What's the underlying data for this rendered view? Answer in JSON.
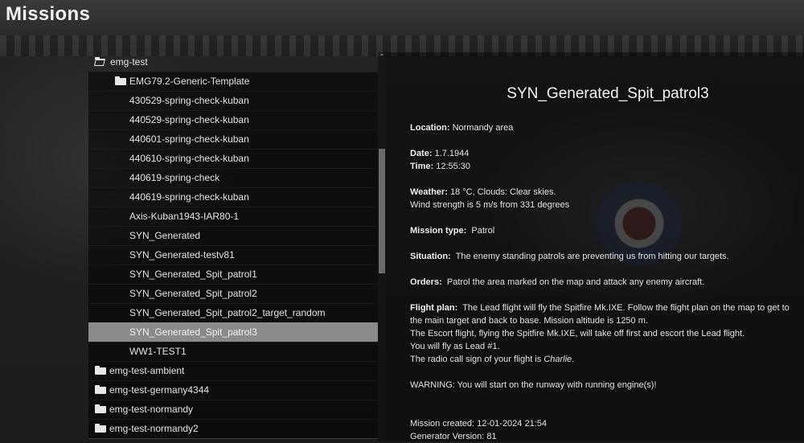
{
  "header": {
    "title": "Missions"
  },
  "tree": {
    "parent_folder": "emg-test",
    "subfolder": "EMG79.2-Generic-Template",
    "missions": [
      "430529-spring-check-kuban",
      "440529-spring-check-kuban",
      "440601-spring-check-kuban",
      "440610-spring-check-kuban",
      "440619-spring-check",
      "440619-spring-check-kuban",
      "Axis-Kuban1943-IAR80-1",
      "SYN_Generated",
      "SYN_Generated-testv81",
      "SYN_Generated_Spit_patrol1",
      "SYN_Generated_Spit_patrol2",
      "SYN_Generated_Spit_patrol2_target_random",
      "SYN_Generated_Spit_patrol3",
      "WW1-TEST1"
    ],
    "selected_mission": "SYN_Generated_Spit_patrol3",
    "sibling_folders": [
      "emg-test-ambient",
      "emg-test-germany4344",
      "emg-test-normandy",
      "emg-test-normandy2"
    ]
  },
  "details": {
    "title": "SYN_Generated_Spit_patrol3",
    "location_label": "Location:",
    "location": "Normandy area",
    "date_label": "Date:",
    "date": "1.7.1944",
    "time_label": "Time:",
    "time": "12:55:30",
    "weather_label": "Weather:",
    "weather": "18 °C, Clouds: Clear skies.",
    "wind": "Wind strength is 5 m/s from 331 degrees",
    "mission_type_label": "Mission type:",
    "mission_type": "Patrol",
    "situation_label": "Situation:",
    "situation": "The enemy standing patrols are preventing us from hitting our targets.",
    "orders_label": "Orders:",
    "orders": "Patrol the area marked on the map and attack any enemy aircraft.",
    "flight_plan_label": "Flight plan:",
    "flight_plan_1": "The Lead flight will fly the Spitfire Mk.IXE. Follow the flight plan on the map to get to",
    "flight_plan_2": "the main target and back to base. Mission altitude is 1250 m.",
    "flight_plan_3": "The Escort flight, flying the Spitfire Mk.IXE, will take off first and escort the Lead flight.",
    "flight_plan_4": "You will fly as Lead #1.",
    "callsign_prefix": "The radio call sign of your flight is ",
    "callsign": "Charlie",
    "callsign_suffix": ".",
    "warning": "WARNING: You will start on the runway with running engine(s)!",
    "created": "Mission created: 12-01-2024 21:54",
    "generator_version": "Generator Version: 81"
  }
}
